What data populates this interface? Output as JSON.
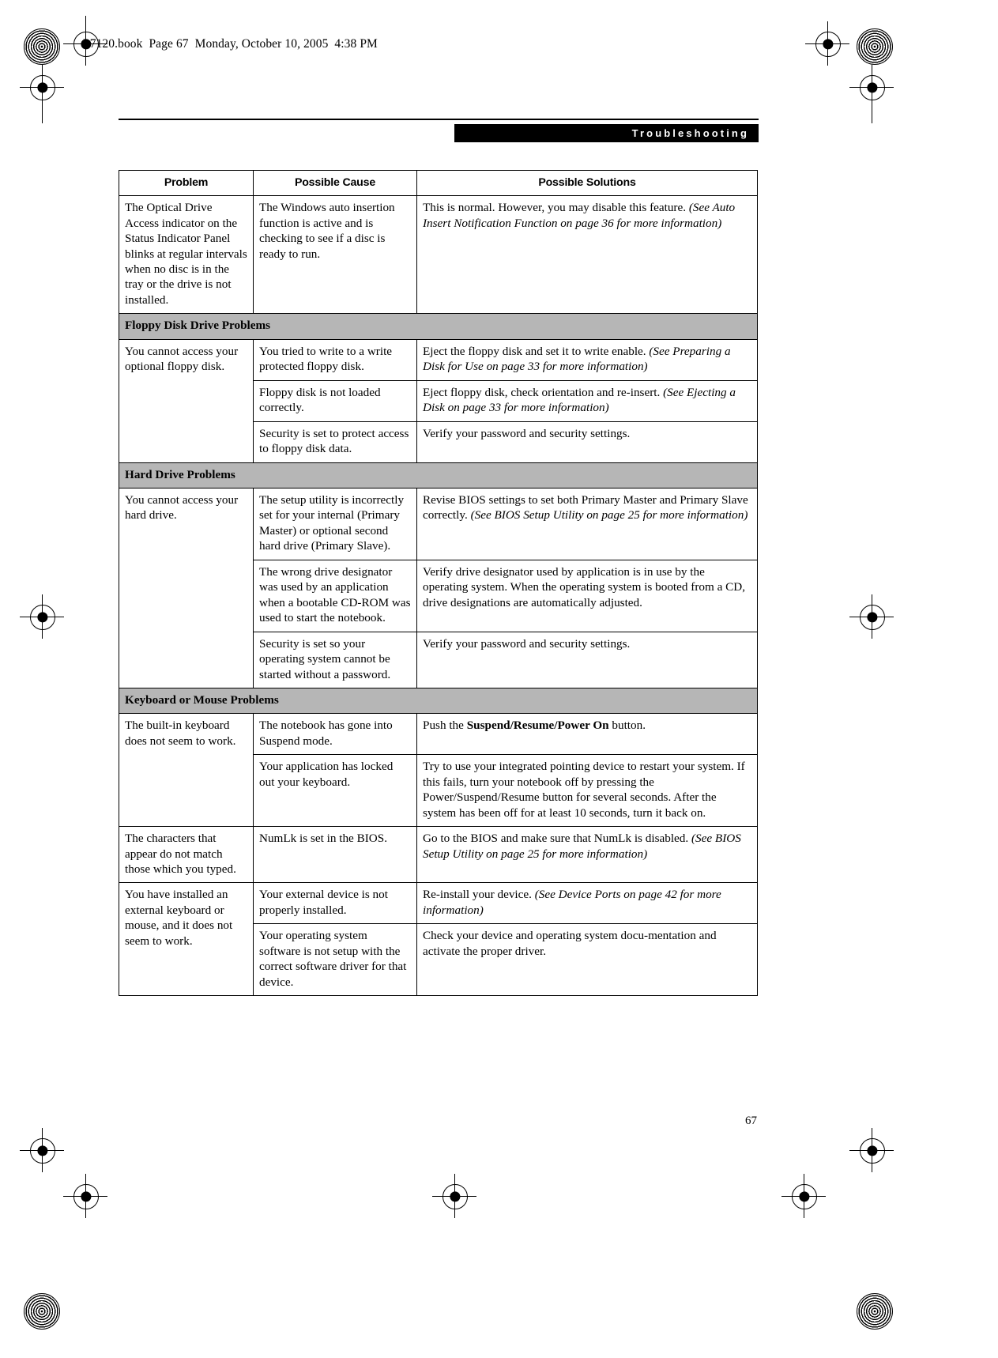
{
  "file_header": "P7120.book  Page 67  Monday, October 10, 2005  4:38 PM",
  "section_banner": "Troubleshooting",
  "page_number": "67",
  "colors": {
    "section_band": "#b6b6b6",
    "banner_background": "#000000",
    "banner_text": "#ffffff",
    "table_border": "#000000"
  },
  "table": {
    "headers": [
      "Problem",
      "Possible Cause",
      "Possible Solutions"
    ],
    "rows": [
      {
        "type": "data",
        "problem": "The Optical Drive Access indicator on the Status Indicator Panel blinks at regular intervals when no disc is in the tray or the drive is not installed.",
        "entries": [
          {
            "cause": "The Windows auto insertion function is active and is checking to see if a disc is ready to run.",
            "solution_plain": "This is normal. However, you may disable this feature. ",
            "solution_italic": "(See Auto Insert Notification Function on page 36 for more information)"
          }
        ]
      },
      {
        "type": "section",
        "label": "Floppy Disk Drive Problems"
      },
      {
        "type": "data",
        "problem": "You cannot access your optional floppy disk.",
        "entries": [
          {
            "cause": "You tried to write to a write protected floppy disk.",
            "solution_plain": "Eject the floppy disk and set it to write enable. ",
            "solution_italic": "(See Preparing a Disk for Use on page 33 for more information)"
          },
          {
            "cause": "Floppy disk is not loaded correctly.",
            "solution_plain": "Eject floppy disk, check orientation and re-insert. ",
            "solution_italic": "(See Ejecting a Disk on page 33 for more information)"
          },
          {
            "cause": "Security is set to protect access to floppy disk data.",
            "solution_plain": "Verify your password and security settings.",
            "solution_italic": ""
          }
        ]
      },
      {
        "type": "section",
        "label": "Hard Drive Problems"
      },
      {
        "type": "data",
        "problem": "You cannot access your hard drive.",
        "entries": [
          {
            "cause": "The setup utility is incorrectly set for your internal (Primary Master) or optional second hard drive (Primary Slave).",
            "solution_plain": "Revise BIOS settings to set both Primary Master and Primary Slave correctly. ",
            "solution_italic": "(See BIOS Setup Utility on page 25 for more information)"
          },
          {
            "cause": "The wrong drive designator was used by an application when a bootable CD-ROM was used to start the notebook.",
            "solution_plain": "Verify drive designator used by application is in use by the operating system. When the operating system is booted from a CD, drive designations are automatically adjusted.",
            "solution_italic": ""
          },
          {
            "cause": "Security is set so your operating system cannot be started without a password.",
            "solution_plain": "Verify your password and security settings.",
            "solution_italic": ""
          }
        ]
      },
      {
        "type": "section",
        "label": "Keyboard or Mouse Problems"
      },
      {
        "type": "data",
        "problem": "The built-in keyboard does not seem to work.",
        "entries": [
          {
            "cause": "The notebook has gone into Suspend mode.",
            "solution_plain": "Push the ",
            "solution_bold": "Suspend/Resume/Power On",
            "solution_plain2": " button."
          },
          {
            "cause": "Your application has locked out your keyboard.",
            "solution_plain": "Try to use your integrated pointing device to restart your system. If this fails, turn your notebook off by pressing the Power/Suspend/Resume button for several seconds. After the system has been off for at least 10 seconds, turn it back on.",
            "solution_italic": ""
          }
        ]
      },
      {
        "type": "data",
        "problem": "The characters that appear do not match those which you typed.",
        "entries": [
          {
            "cause": "NumLk is set in the BIOS.",
            "solution_plain": "Go to the BIOS and make sure that NumLk is disabled. ",
            "solution_italic": "(See BIOS Setup Utility on page 25 for more information)"
          }
        ]
      },
      {
        "type": "data",
        "problem": "You have installed an external keyboard or mouse, and it does not seem to work.",
        "entries": [
          {
            "cause": "Your external device is not properly installed.",
            "solution_plain": "Re-install your device. ",
            "solution_italic": "(See Device Ports on page 42 for more information)"
          },
          {
            "cause": "Your operating system software is not setup with the correct software driver for that device.",
            "solution_plain": "Check your device and operating system docu-mentation and activate the proper driver.",
            "solution_italic": ""
          }
        ]
      }
    ]
  }
}
